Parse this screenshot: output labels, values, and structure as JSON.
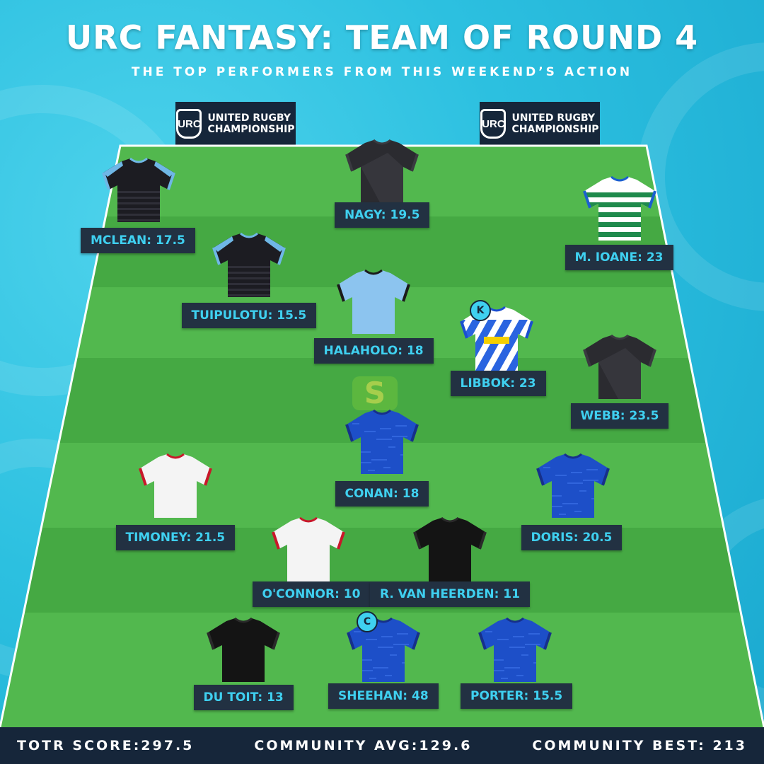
{
  "header": {
    "title": "URC FANTASY: TEAM OF ROUND 4",
    "subtitle": "THE TOP PERFORMERS FROM THIS WEEKEND’S ACTION"
  },
  "brand": {
    "logo_text": "URC",
    "line1": "UNITED RUGBY",
    "line2": "CHAMPIONSHIP"
  },
  "players": [
    {
      "label": "MCLEAN: 17.5",
      "kit": "black-sky"
    },
    {
      "label": "NAGY: 19.5",
      "kit": "black"
    },
    {
      "label": "M. IOANE: 23",
      "kit": "green-hoops"
    },
    {
      "label": "TUIPULOTU: 15.5",
      "kit": "black-sky"
    },
    {
      "label": "HALAHOLO: 18",
      "kit": "sky"
    },
    {
      "label": "LIBBOK: 23",
      "kit": "stormers",
      "badge": "K"
    },
    {
      "label": "WEBB: 23.5",
      "kit": "black"
    },
    {
      "label": "CONAN: 18",
      "kit": "leinster"
    },
    {
      "label": "TIMONEY: 21.5",
      "kit": "ulster"
    },
    {
      "label": "DORIS: 20.5",
      "kit": "leinster"
    },
    {
      "label": "O'CONNOR: 10",
      "kit": "ulster"
    },
    {
      "label": "R. VAN HEERDEN: 11",
      "kit": "sharks"
    },
    {
      "label": "DU TOIT: 13",
      "kit": "sharks"
    },
    {
      "label": "SHEEHAN: 48",
      "kit": "leinster",
      "badge": "C"
    },
    {
      "label": "PORTER: 15.5",
      "kit": "leinster"
    }
  ],
  "footer": {
    "totr_score": "TOTR SCORE:297.5",
    "community_avg": "COMMUNITY AVG:129.6",
    "community_best": "COMMUNITY BEST: 213"
  },
  "colors": {
    "sky": "#2cc0e0",
    "navy": "#16263a",
    "accent_text": "#3fd0f0",
    "pitch_light": "#4cb04a",
    "pitch_dark": "#3f9f3f"
  },
  "icons": [
    "urc-logo-icon",
    "captain-badge-icon",
    "kicker-badge-icon",
    "jersey-icon"
  ]
}
